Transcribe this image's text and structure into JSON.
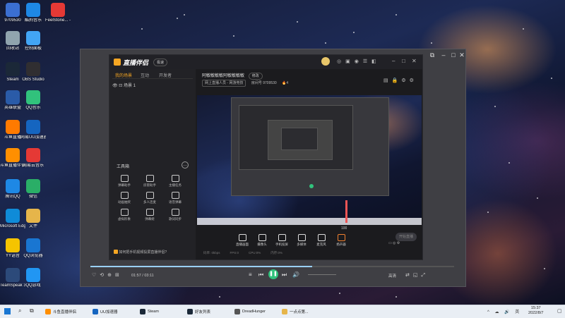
{
  "desktop": {
    "icons": [
      {
        "label": "9709530",
        "color": "#3b6fd1"
      },
      {
        "label": "酷狗音乐",
        "color": "#1e88e5"
      },
      {
        "label": "FeelStone... - 通文件",
        "color": "#e53935"
      },
      {
        "label": "回收站",
        "color": "#90a4ae"
      },
      {
        "label": "控制面板",
        "color": "#42a5f5"
      },
      {
        "label": "Steam",
        "color": "#1b2838"
      },
      {
        "label": "OBS Studio",
        "color": "#302e31"
      },
      {
        "label": "英雄联盟",
        "color": "#2a5ba8"
      },
      {
        "label": "QQ音乐",
        "color": "#31c27c"
      },
      {
        "label": "斗鱼直播",
        "color": "#ff7a00"
      },
      {
        "label": "网易UU加速器",
        "color": "#1565c0"
      },
      {
        "label": "斗鱼直播伴侣",
        "color": "#ff8f00"
      },
      {
        "label": "网易云音乐",
        "color": "#e53935"
      },
      {
        "label": "腾讯QQ",
        "color": "#1e88e5"
      },
      {
        "label": "微信",
        "color": "#2aae67"
      },
      {
        "label": "Microsoft Edge",
        "color": "#0f8bd8"
      },
      {
        "label": "文件",
        "color": "#e6b54a"
      },
      {
        "label": "YY语音",
        "color": "#f5c400"
      },
      {
        "label": "QQ浏览器",
        "color": "#1976d2"
      },
      {
        "label": "TeamSpeak 3",
        "color": "#2c4a7a"
      },
      {
        "label": "QQ游戏",
        "color": "#2196f3"
      }
    ]
  },
  "app": {
    "logo": "直播伴侣",
    "version_pill": "极速",
    "side_tabs": [
      "我的场景",
      "互动",
      "开发者"
    ],
    "scene_item": "场景 1",
    "tools_title": "工具箱",
    "tools": [
      "弹幕助手",
      "房管助手",
      "主播任务",
      "动画抽奖",
      "多人连麦",
      "语音弹幕",
      "虚拟形象",
      "弹幕姬",
      "歌词同步"
    ],
    "tip": "如何把手机视频投屏直播伴侣?",
    "stream_title": "阿敏敏敏敏阿敏敏敏敏",
    "edit_pill": "修改",
    "category": "网上直播人员 - 网游竞技",
    "room_label": "房间号",
    "room_id": "9709530",
    "likes": "4",
    "controls": [
      "直播画面",
      "摄像头",
      "手机投屏",
      "多媒体",
      "麦克风",
      "扬声器"
    ],
    "volume_value": "100",
    "start_button": "开始直播",
    "status_items": [
      "码率: 0kbps",
      "FPS:0",
      "CPU:0%",
      "内存:0%"
    ]
  },
  "player": {
    "time": "01:57 / 03:11",
    "right_label": "高清"
  },
  "taskbar": {
    "items": [
      "斗鱼直播伴侣",
      "UU加速器",
      "Steam",
      "好友列表",
      "DreadHunger",
      "一点点第..."
    ],
    "time": "15:37",
    "date": "2022/8/7"
  }
}
